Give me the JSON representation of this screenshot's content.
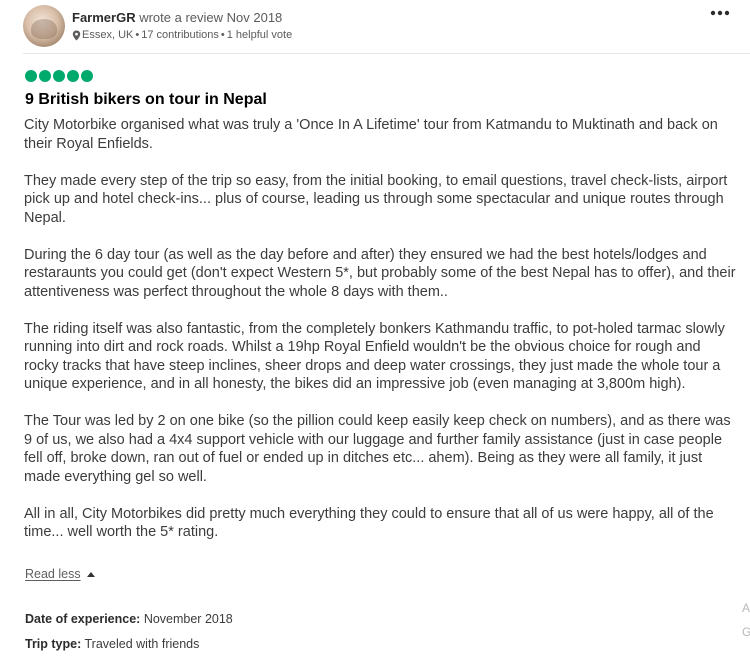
{
  "review": {
    "user": {
      "name": "FarmerGR",
      "action": "wrote a review Nov 2018",
      "location": "Essex, UK",
      "contributions": "17 contributions",
      "helpful": "1 helpful vote",
      "separator": "•"
    },
    "more_label": "•••",
    "rating_bubbles": 5,
    "rating_color": "#00aa6c",
    "title": "9 British bikers on tour in Nepal",
    "paragraphs": [
      "City Motorbike organised what was truly a 'Once In A Lifetime' tour from Katmandu to Muktinath and back on their Royal Enfields.",
      "They made every step of the trip so easy, from the initial booking, to email questions, travel check-lists, airport pick up and hotel check-ins... plus of course, leading us through some spectacular and unique routes through Nepal.",
      "During the 6 day tour (as well as the day before and after) they ensured we had the best hotels/lodges and restaraunts you could get (don't expect Western 5*, but probably some of the best Nepal has to offer), and their attentiveness was perfect throughout the whole 8 days with them..",
      "The riding itself was also fantastic, from the completely bonkers Kathmandu traffic, to pot-holed tarmac slowly running into dirt and rock roads. Whilst a 19hp Royal Enfield wouldn't be the obvious choice for rough and rocky tracks that have steep inclines, sheer drops and deep water crossings, they just made the whole tour a unique experience, and in all honesty, the bikes did an impressive job (even managing at 3,800m high).",
      "The Tour was led by 2 on one bike (so the pillion could keep easily keep check on numbers), and as there was 9 of us, we also had a 4x4 support vehicle with our luggage and further family assistance (just in case people fell off, broke down, ran out of fuel or ended up in ditches etc... ahem). Being as they were all family, it just made everything gel so well.",
      "All in all, City Motorbikes did pretty much everything they could to ensure that all of us were happy, all of the time... well worth the 5* rating."
    ],
    "read_less_label": "Read less",
    "date_of_experience": {
      "label": "Date of experience:",
      "value": "November 2018"
    },
    "trip_type": {
      "label": "Trip type:",
      "value": "Traveled with friends"
    }
  },
  "edge_marks": [
    "A",
    "G"
  ]
}
